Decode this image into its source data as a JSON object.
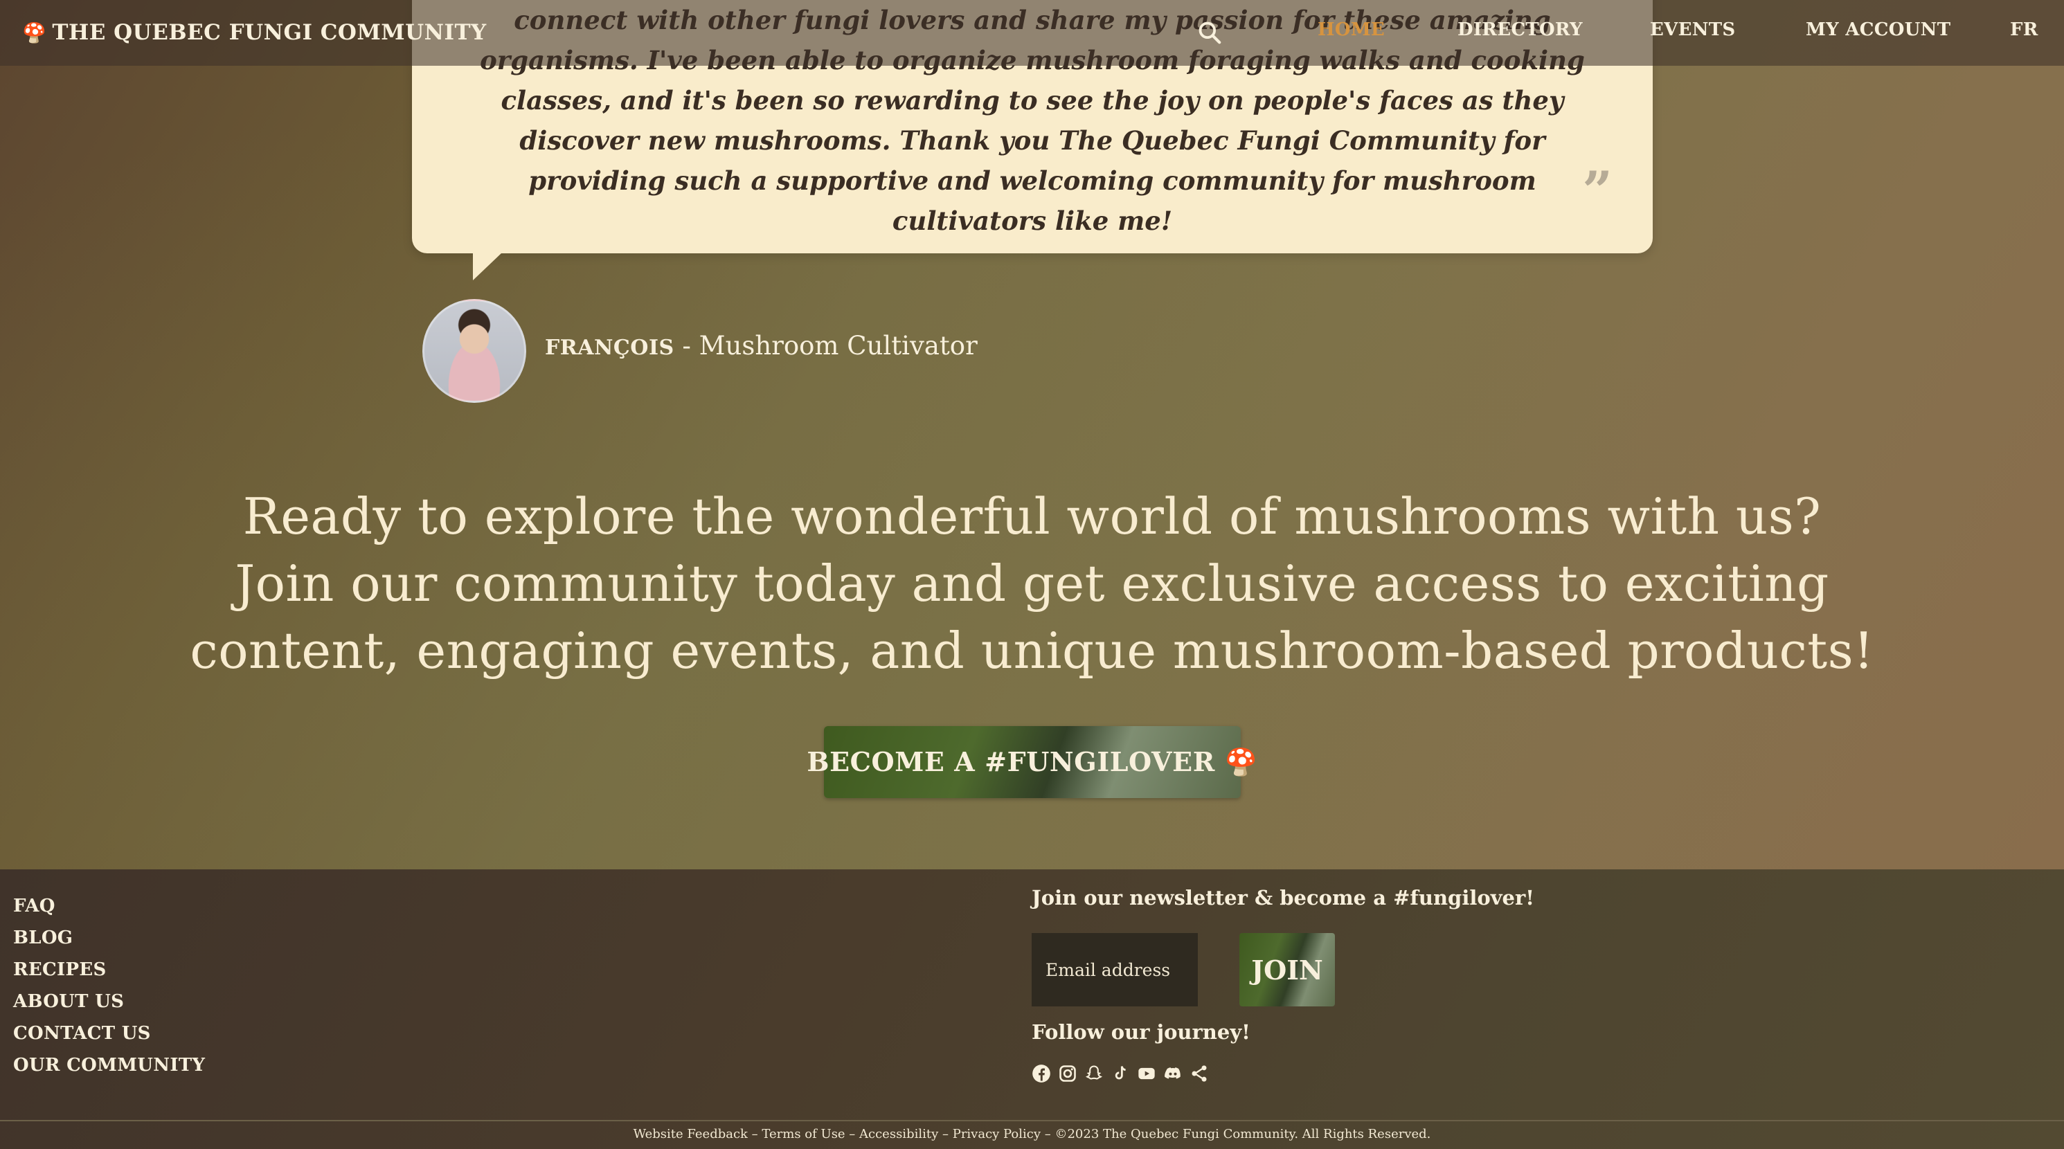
{
  "header": {
    "brand": "THE QUEBEC FUNGI COMMUNITY",
    "brand_icon": "mushroom-emoji",
    "nav": [
      {
        "label": "HOME",
        "active": true
      },
      {
        "label": "DIRECTORY"
      },
      {
        "label": "EVENTS"
      },
      {
        "label": "MY ACCOUNT"
      },
      {
        "label": "FR"
      }
    ],
    "search_icon": "search-icon"
  },
  "testimonial": {
    "text": "connect with other fungi lovers and share my passion for these amazing organisms. I've been able to organize mushroom foraging walks and cooking classes, and it's been so rewarding to see the joy on people's faces as they discover new mushrooms. Thank you The Quebec Fungi Community for providing such a supportive and welcoming community for mushroom cultivators like me!",
    "quote_mark": "99",
    "author_name": "FRANÇOIS",
    "author_role": " - Mushroom Cultivator"
  },
  "cta": {
    "line1": "Ready to explore the wonderful world of mushrooms with us?",
    "line2": "Join our community today and get exclusive access to exciting content, engaging events, and unique mushroom-based products!",
    "button_label": "BECOME A #FUNGILOVER 🍄"
  },
  "footer": {
    "links": [
      "FAQ",
      "BLOG",
      "RECIPES",
      "ABOUT US",
      "CONTACT US",
      "OUR COMMUNITY"
    ],
    "newsletter_title": "Join our newsletter & become a #fungilover!",
    "email_placeholder": "Email address",
    "join_label": "JOIN",
    "follow_title": "Follow our journey!",
    "social_icons": [
      "facebook-icon",
      "instagram-icon",
      "snapchat-icon",
      "tiktok-icon",
      "youtube-icon",
      "discord-icon",
      "share-icon"
    ],
    "legal": "Website Feedback – Terms of Use – Accessibility – Privacy Policy – ©2023 The Quebec Fungi Community. All Rights Reserved."
  },
  "colors": {
    "accent_active_nav": "#d7943f",
    "card_bg": "#f9eccb",
    "text_light": "#f8f0dc"
  }
}
